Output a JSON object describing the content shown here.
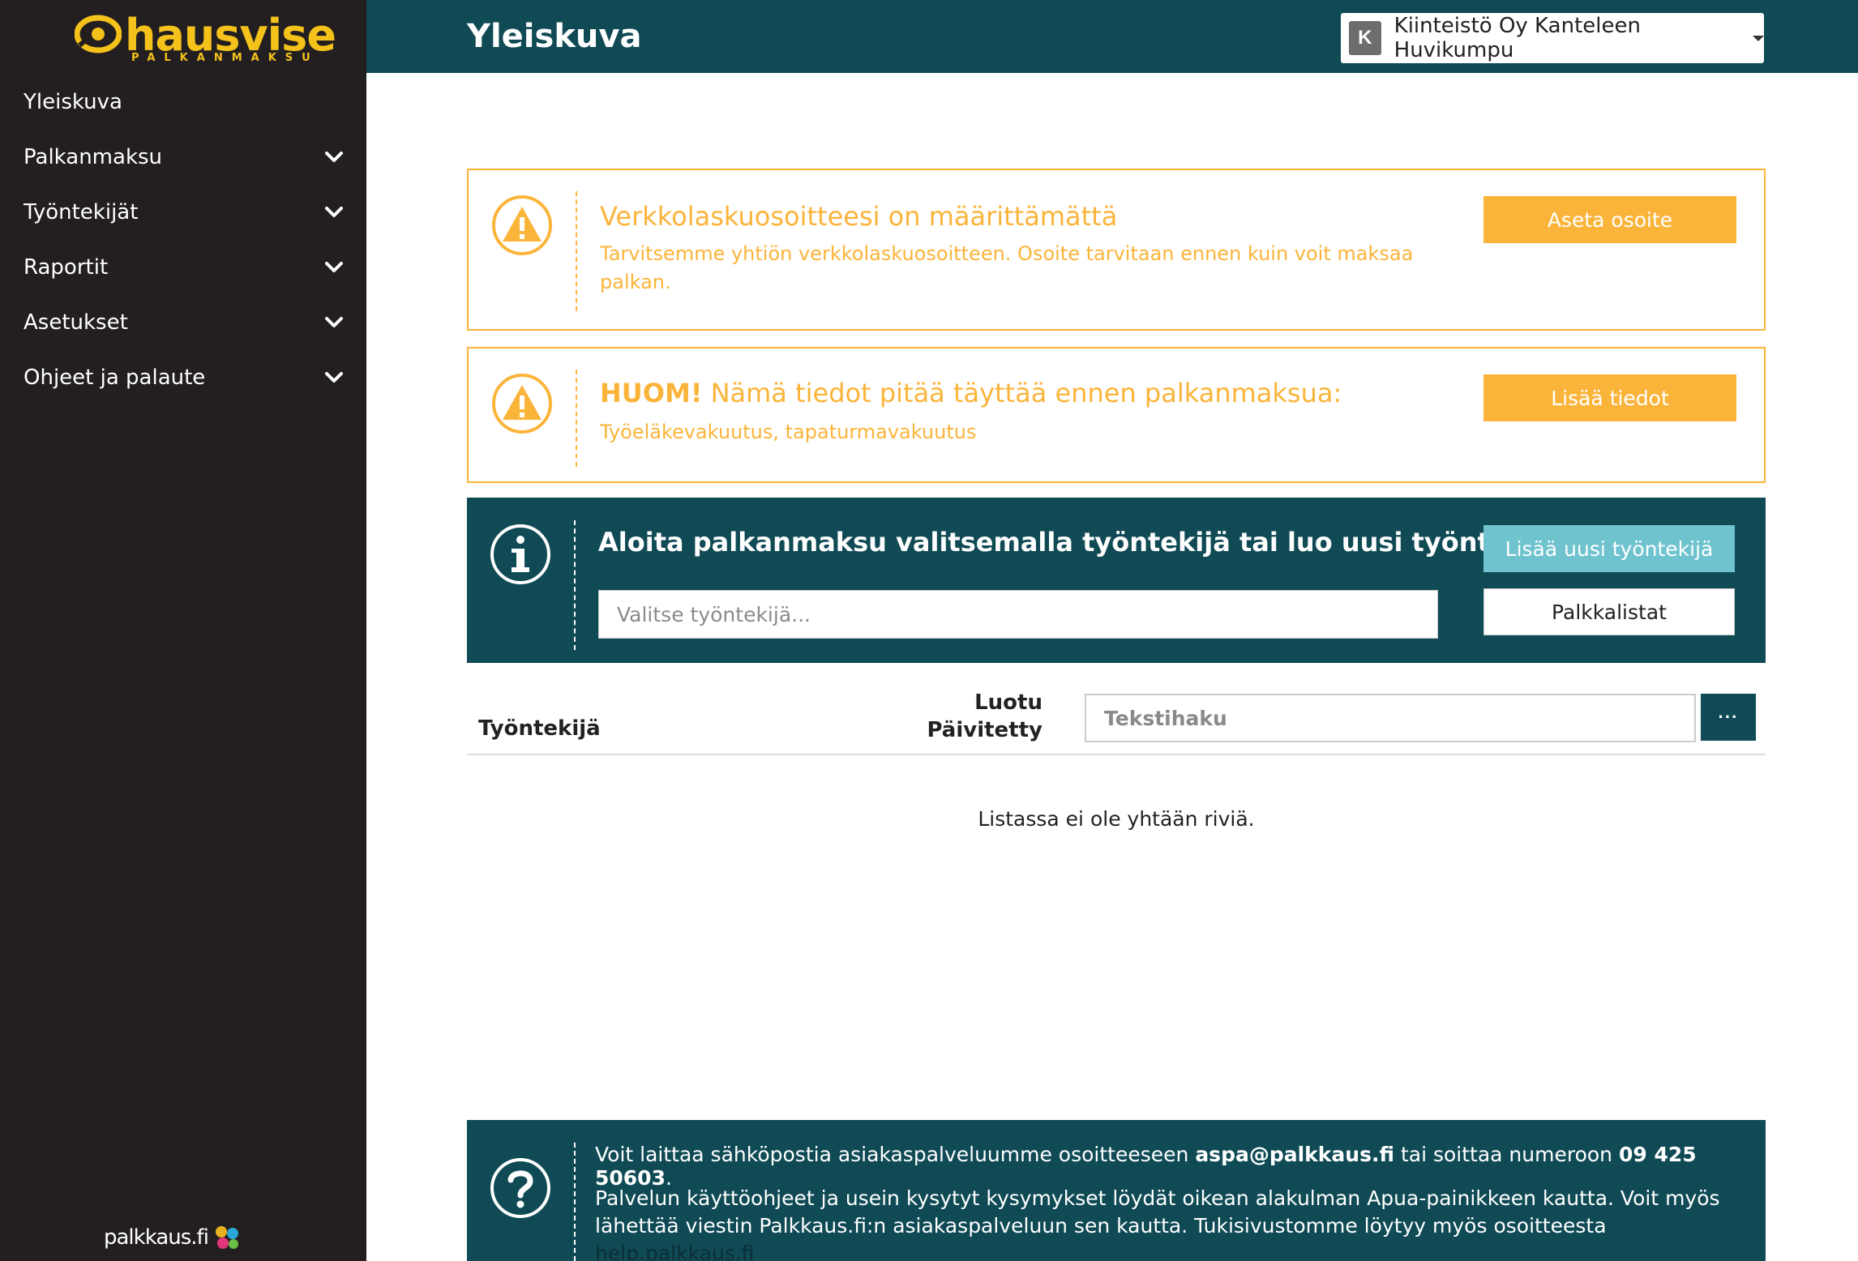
{
  "sidebar": {
    "logo_text": "hausvise",
    "logo_sub": "PALKANMAKSU",
    "items": [
      {
        "label": "Yleiskuva",
        "expandable": false
      },
      {
        "label": "Palkanmaksu",
        "expandable": true
      },
      {
        "label": "Työntekijät",
        "expandable": true
      },
      {
        "label": "Raportit",
        "expandable": true
      },
      {
        "label": "Asetukset",
        "expandable": true
      },
      {
        "label": "Ohjeet ja palaute",
        "expandable": true
      }
    ],
    "footer_brand": "palkkaus.fi"
  },
  "header": {
    "title": "Yleiskuva",
    "company_initial": "K",
    "company_name": "Kiinteistö Oy Kanteleen Huvikumpu"
  },
  "alerts": {
    "einvoice": {
      "title": "Verkkolaskuosoitteesi on määrittämättä",
      "text": "Tarvitsemme yhtiön verkkolaskuosoitteen. Osoite tarvitaan ennen kuin voit maksaa palkan.",
      "button": "Aseta osoite"
    },
    "required": {
      "title_bold": "HUOM!",
      "title_rest": " Nämä tiedot pitää täyttää ennen palkanmaksua:",
      "text": "Työeläkevakuutus, tapaturmavakuutus",
      "button": "Lisää tiedot"
    }
  },
  "start": {
    "title_pre": "Aloita palkanmaksu valitsemalla työntekijä ",
    "title_bold": "tai",
    "title_post": " luo uusi työntekijä",
    "employee_placeholder": "Valitse työntekijä...",
    "new_employee_button": "Lisää uusi työntekijä",
    "payroll_lists_button": "Palkkalistat"
  },
  "table": {
    "col_employee": "Työntekijä",
    "col_created": "Luotu",
    "col_updated": "Päivitetty",
    "search_placeholder": "Tekstihaku",
    "more_button": "···",
    "empty_message": "Listassa ei ole yhtään riviä."
  },
  "help": {
    "line1_pre": "Voit laittaa sähköpostia asiakaspalveluumme osoitteeseen ",
    "email": "aspa@palkkaus.fi",
    "line1_mid": " tai soittaa numeroon ",
    "phone": "09 425 50603",
    "line1_end": ".",
    "line2": "Palvelun käyttöohjeet ja usein kysytyt kysymykset löydät oikean alakulman Apua-painikkeen kautta. Voit myös lähettää viestin Palkkaus.fi:n asiakaspalveluun sen kautta. Tukisivustomme löytyy myös osoitteesta ",
    "link": "help.palkkaus.fi"
  },
  "colors": {
    "sidebar_bg": "#231f20",
    "header_bg": "#0f4a55",
    "warning": "#fbb43a",
    "accent_teal": "#6ec3cf",
    "logo_yellow": "#f5c21b"
  },
  "icons": {
    "nav_chevron": "chevron-down-icon",
    "alert": "warning-triangle-icon",
    "info": "info-circle-icon",
    "help": "question-circle-icon"
  }
}
